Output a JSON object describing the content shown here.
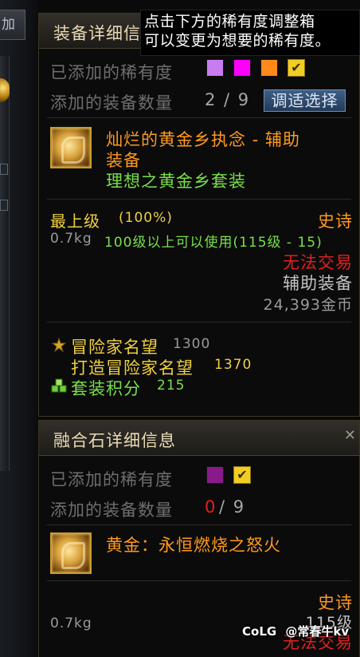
{
  "background": {
    "left_tab_label": "加",
    "colors": {
      "panel_border": "#3b3524",
      "header_text": "#e9d9b4",
      "epic_orange": "#ff9a1e",
      "set_green": "#78e04a",
      "gold_yellow": "#f0d040",
      "untradeable_red": "#e02020"
    }
  },
  "tooltip": {
    "line1": "点击下方的稀有度调整箱",
    "line2": "可以变更为想要的稀有度。"
  },
  "panel1": {
    "title": "装备详细信",
    "rarity_label": "已添加的稀有度",
    "rarity_swatches": [
      "#c97cf0",
      "#ff00ff",
      "#ff8a1a",
      "check"
    ],
    "count_label": "添加的装备数量",
    "count_value": "2 / 9",
    "adjust_button": "调适选择",
    "item": {
      "icon": "golden-hand-icon",
      "name_line1": "灿烂的黄金乡执念 - 辅助",
      "name_line2": "装备",
      "set_name": "理想之黄金乡套装"
    },
    "grade": "最上级",
    "grade_pct": "(100%)",
    "rarity": "史诗",
    "weight": "0.7kg",
    "level_req": "100级以上可以使用(115级 - 15)",
    "trade": "无法交易",
    "type": "辅助装备",
    "price": "24,393金币",
    "stats": [
      {
        "icon": "wreath-icon",
        "label": "冒险家名望",
        "value": "1300"
      },
      {
        "icon": "",
        "label": "打造冒险家名望",
        "value": "1370"
      },
      {
        "icon": "set-points-icon",
        "label": "套装积分",
        "value": "215"
      }
    ]
  },
  "panel2": {
    "title": "融合石详细信息",
    "rarity_label": "已添加的稀有度",
    "rarity_swatches": [
      "#8a1a8a",
      "check"
    ],
    "count_label": "添加的装备数量",
    "count_value_a": "0",
    "count_value_b": "/ 9",
    "item": {
      "icon": "golden-dragon-icon",
      "name": "黄金：永恒燃烧之怒火"
    },
    "rarity": "史诗",
    "weight": "0.7kg",
    "level": "115级",
    "trade": "无法交易"
  },
  "watermark": {
    "logo": "CoLG",
    "handle": "@常春牛kv"
  }
}
